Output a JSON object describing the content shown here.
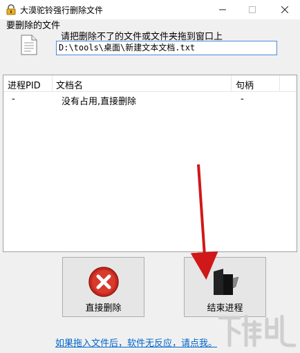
{
  "window": {
    "title": "大漠驼铃强行删除文件",
    "controls": {
      "minimize": "—",
      "maximize": "☐",
      "close": "✕"
    }
  },
  "file_group": {
    "label": "要删除的文件",
    "hint": "请把删除不了的文件或文件夹拖到窗口上",
    "path_value": "D:\\tools\\桌面\\新建文本文档.txt"
  },
  "process_list": {
    "columns": [
      "进程PID",
      "文档名",
      "句柄"
    ],
    "rows": [
      {
        "pid": "-",
        "doc": "没有占用,直接删除",
        "handle": "-"
      }
    ]
  },
  "actions": {
    "delete_label": "直接删除",
    "end_process_label": "结束进程"
  },
  "help_link": "如果拖入文件后，软件无反应，请点我。",
  "watermark": "下载吧",
  "colors": {
    "delete_red": "#c8281e",
    "link_blue": "#0066cc",
    "arrow_red": "#d01818"
  }
}
